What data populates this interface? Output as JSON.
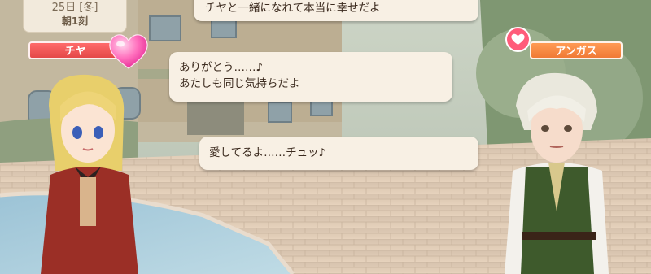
{
  "status": {
    "date": "25日 [冬]",
    "time": "朝1刻"
  },
  "characters": {
    "left": {
      "name": "チヤ"
    },
    "right": {
      "name": "アンガス"
    }
  },
  "dialogue": [
    {
      "text": "チヤと一緒になれて本当に幸せだよ"
    },
    {
      "line1": "ありがとう……♪",
      "line2": "あたしも同じ気持ちだよ"
    },
    {
      "text": "愛してるよ……チュッ♪"
    }
  ],
  "colors": {
    "name_left": "#e44848",
    "name_right": "#f07a35",
    "bubble": "#f8f0e4",
    "heart": "#ff5c7a"
  },
  "icons": {
    "affection_big": "heart-icon",
    "affection_small": "heart-icon"
  }
}
